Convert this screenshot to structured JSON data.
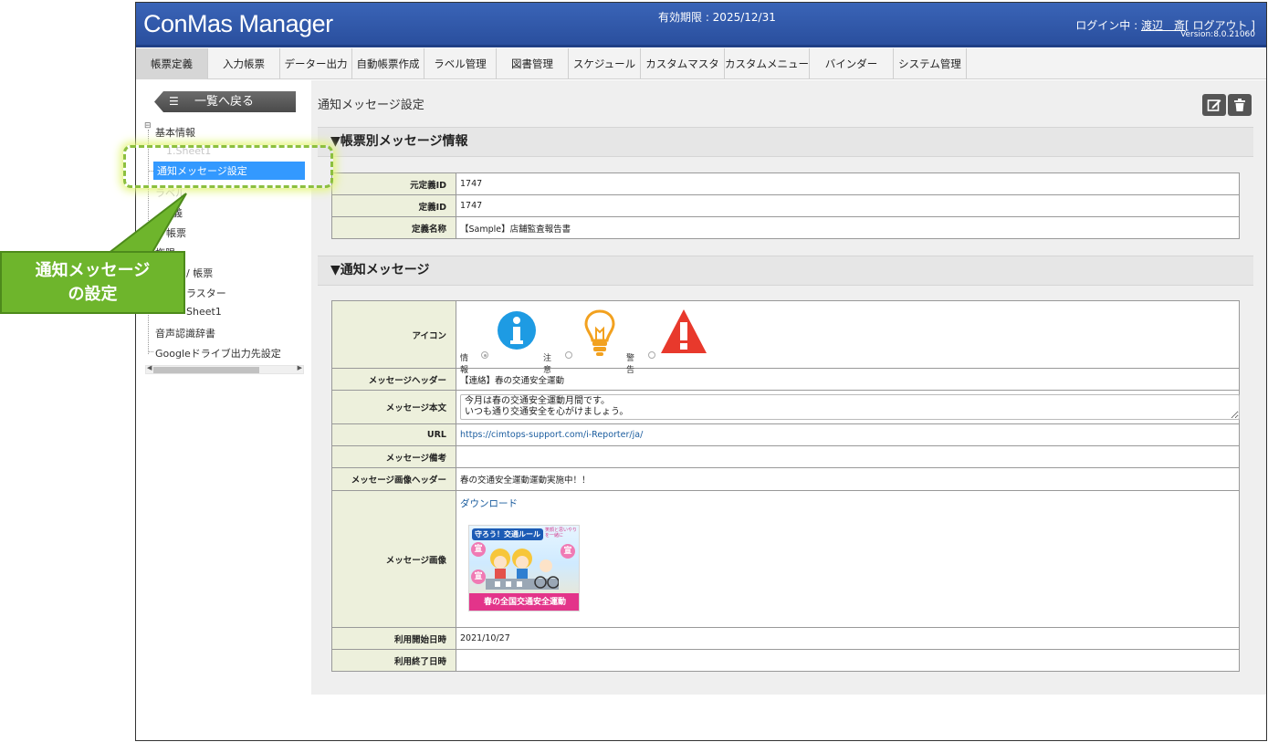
{
  "app": {
    "logo": "ConMas Manager",
    "expiry": "有効期限 : 2025/12/31",
    "user_prefix": "ログイン中 : ",
    "user_name": "渡辺　斎",
    "logout": "[ ログアウト ]",
    "version": "Version:8.0.21060"
  },
  "menu": [
    "帳票定義",
    "入力帳票",
    "データー出力",
    "自動帳票作成",
    "ラベル管理",
    "図書管理",
    "スケジュール",
    "カスタムマスター",
    "カスタムメニュー",
    "バインダー",
    "システム管理"
  ],
  "sidebar": {
    "back_label": "一覧へ戻る",
    "tree": {
      "basic_info": "基本情報",
      "sheet1_dim": "1.Sheet1",
      "notify_settings": "通知メッセージ設定",
      "label_dim": "ラベル",
      "def_partial": "義",
      "form_partial": "帳票",
      "perm_partial": "権限",
      "slash_form_partial": "/ 帳票",
      "master_partial": "ラスター",
      "sheet1_partial": "Sheet1",
      "voice_dict": "音声認識辞書",
      "gdrive": "Googleドライブ出力先設定"
    }
  },
  "main": {
    "page_title": "通知メッセージ設定",
    "edit_icon": "edit-icon",
    "delete_icon": "trash-icon",
    "section1_title": "▼帳票別メッセージ情報",
    "section2_title": "▼通知メッセージ",
    "info_rows": [
      {
        "label": "元定義ID",
        "value": "1747"
      },
      {
        "label": "定義ID",
        "value": "1747"
      },
      {
        "label": "定義名称",
        "value": "【Sample】店舗監査報告書"
      }
    ],
    "msg": {
      "icon_label": "アイコン",
      "icon_options": [
        {
          "label": "情報",
          "icon": "info-icon",
          "color": "#1e9be3",
          "selected": true
        },
        {
          "label": "注意",
          "icon": "lightbulb-icon",
          "color": "#f2a11f",
          "selected": false
        },
        {
          "label": "警告",
          "icon": "warning-icon",
          "color": "#e8392c",
          "selected": false
        }
      ],
      "header_label": "メッセージヘッダー",
      "header_value": "【連絡】春の交通安全運動",
      "body_label": "メッセージ本文",
      "body_value": "今月は春の交通安全運動月間です。\nいつも通り交通安全を心がけましょう。",
      "url_label": "URL",
      "url_value": "https://cimtops-support.com/i-Reporter/ja/",
      "note_label": "メッセージ備考",
      "note_value": "",
      "image_header_label": "メッセージ画像ヘッダー",
      "image_header_value": "春の交通安全運動運動実施中！！",
      "image_label": "メッセージ画像",
      "download_label": "ダウンロード",
      "poster": {
        "title": "守ろう！交通ルール",
        "subtitle": "笑顔と思いやりを一緒に",
        "banner": "春の全国交通安全運動",
        "side_char": "宣"
      },
      "start_label": "利用開始日時",
      "start_value": "2021/10/27",
      "end_label": "利用終了日時",
      "end_value": ""
    }
  },
  "callout": {
    "line1": "通知メッセージ",
    "line2": "の設定",
    "color": "#6eb52c"
  }
}
